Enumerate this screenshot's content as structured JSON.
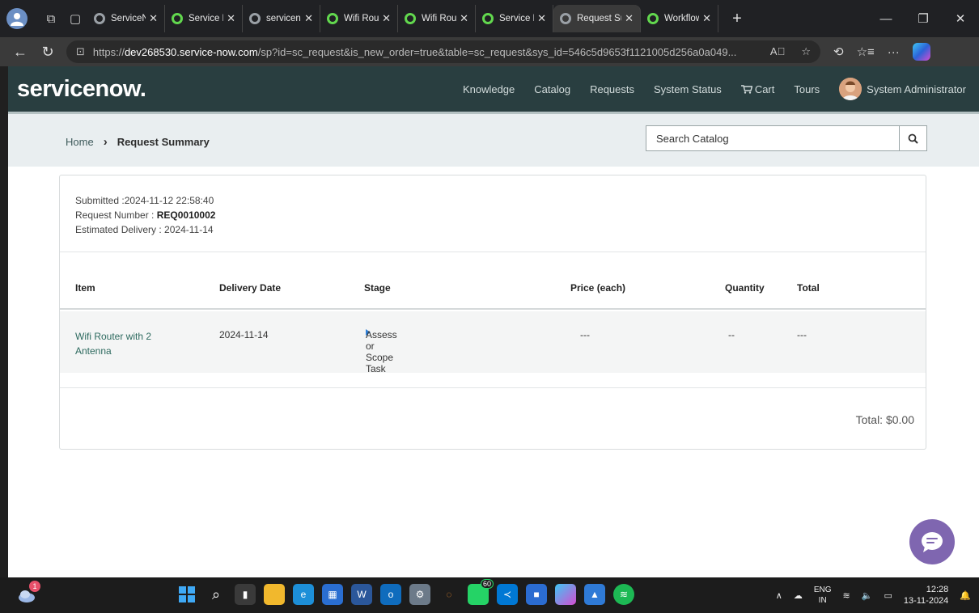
{
  "browser": {
    "tabs": [
      {
        "title": "ServiceNow",
        "active": false
      },
      {
        "title": "Service Portal",
        "active": false
      },
      {
        "title": "servicenow",
        "active": false
      },
      {
        "title": "Wifi Router",
        "active": false
      },
      {
        "title": "Wifi Router",
        "active": false
      },
      {
        "title": "Service Portal",
        "active": false
      },
      {
        "title": "Request Summary",
        "active": true
      },
      {
        "title": "Workflow",
        "active": false
      }
    ],
    "url_prefix": "https://",
    "url_host": "dev268530.service-now.com",
    "url_path": "/sp?id=sc_request&is_new_order=true&table=sc_request&sys_id=546c5d9653f1121005d256a0a049..."
  },
  "header": {
    "logo": "servicenow.",
    "nav": {
      "knowledge": "Knowledge",
      "catalog": "Catalog",
      "requests": "Requests",
      "system_status": "System Status",
      "cart": "Cart",
      "tours": "Tours"
    },
    "user": "System Administrator"
  },
  "breadcrumb": {
    "home": "Home",
    "current": "Request Summary"
  },
  "search": {
    "placeholder": "Search Catalog"
  },
  "summary": {
    "submitted_label": "Submitted :",
    "submitted_value": "2024-11-12 22:58:40",
    "request_label": "Request Number : ",
    "request_value": "REQ0010002",
    "delivery_label": "Estimated Delivery : ",
    "delivery_value": "2024-11-14"
  },
  "table": {
    "headers": {
      "item": "Item",
      "delivery_date": "Delivery Date",
      "stage": "Stage",
      "price": "Price (each)",
      "quantity": "Quantity",
      "total": "Total"
    },
    "rows": [
      {
        "item": "Wifi Router with 2 Antenna",
        "delivery_date": "2024-11-14",
        "stage": "Assess or Scope Task",
        "price": "---",
        "quantity": "--",
        "total": "---"
      }
    ]
  },
  "total_label": "Total: $0.00",
  "taskbar": {
    "weather_badge": "1",
    "whatsapp_badge": "60",
    "lang_top": "ENG",
    "lang_bottom": "IN",
    "time": "12:28",
    "date": "13-11-2024"
  },
  "colors": {
    "header_bg": "#293e40",
    "link": "#2d6a5f",
    "chat_button": "#7f66b0"
  }
}
